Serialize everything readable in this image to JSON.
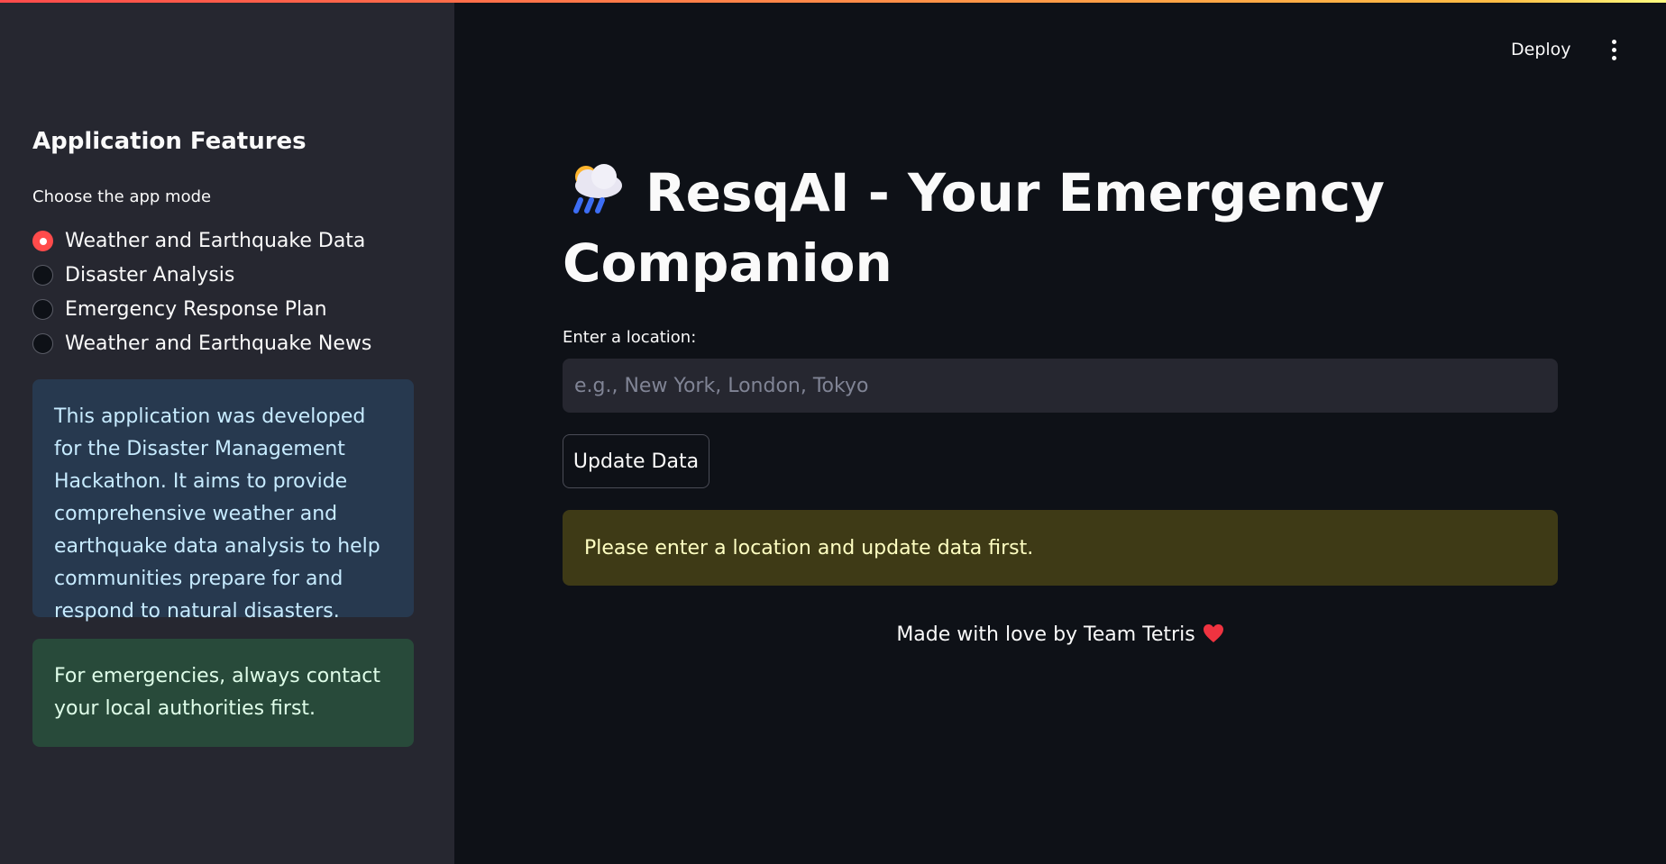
{
  "sidebar": {
    "title": "Application Features",
    "radio_label": "Choose the app mode",
    "modes": [
      {
        "label": "Weather and Earthquake Data",
        "selected": true
      },
      {
        "label": "Disaster Analysis",
        "selected": false
      },
      {
        "label": "Emergency Response Plan",
        "selected": false
      },
      {
        "label": "Weather and Earthquake News",
        "selected": false
      }
    ],
    "info_text": "This application was developed for the Disaster Management Hackathon. It aims to provide comprehensive weather and earthquake data analysis to help communities prepare for and respond to natural disasters.",
    "success_text": "For emergencies, always contact your local authorities first."
  },
  "header": {
    "deploy_label": "Deploy",
    "menu_icon": "vertical-ellipsis-icon"
  },
  "main": {
    "title_icon": "cloud-rain-sun-icon",
    "title": "ResqAI - Your Emergency Companion",
    "input_label": "Enter a location:",
    "input_placeholder": "e.g., New York, London, Tokyo",
    "input_value": "",
    "button_label": "Update Data",
    "warning_text": "Please enter a location and update data first.",
    "footer_text": "Made with love by Team Tetris",
    "footer_icon": "heart-icon"
  },
  "colors": {
    "accent": "#ff4b4b",
    "background": "#0e1117",
    "sidebar": "#262730",
    "info_bg": "#27394f",
    "success_bg": "#284a3a",
    "warning_bg": "#3e3a16"
  }
}
